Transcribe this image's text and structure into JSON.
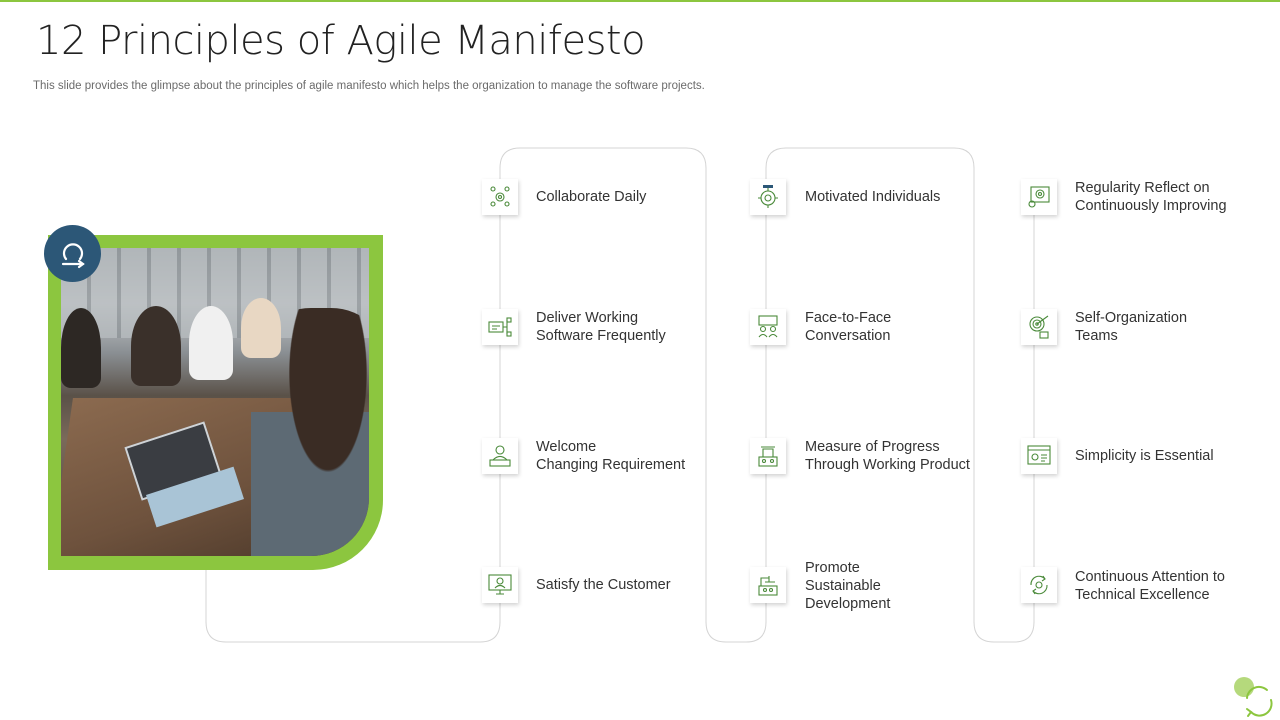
{
  "slide": {
    "title": "12 Principles of Agile Manifesto",
    "subtitle": "This slide provides the glimpse about the principles of agile manifesto which helps the organization to manage the software projects."
  },
  "colors": {
    "accent": "#8cc63f",
    "badge": "#2c5777",
    "line": "#d4d4d4"
  },
  "badge_icon": "scrum-cycle-icon",
  "principles": [
    {
      "label": "Collaborate Daily",
      "icon": "team-collaboration-icon"
    },
    {
      "label": "Deliver Working\nSoftware Frequently",
      "icon": "software-delivery-icon"
    },
    {
      "label": "Welcome\nChanging Requirement",
      "icon": "person-desk-icon"
    },
    {
      "label": "Satisfy the Customer",
      "icon": "customer-screen-icon"
    },
    {
      "label": "Motivated Individuals",
      "icon": "gear-person-icon"
    },
    {
      "label": "Face-to-Face\nConversation",
      "icon": "conversation-icon"
    },
    {
      "label": "Measure of Progress\nThrough Working Product",
      "icon": "progress-machine-icon"
    },
    {
      "label": "Promote\nSustainable\nDevelopment",
      "icon": "development-machine-icon"
    },
    {
      "label": "Regularity Reflect on\nContinuously Improving",
      "icon": "improvement-gear-icon"
    },
    {
      "label": "Self-Organization\nTeams",
      "icon": "target-team-icon"
    },
    {
      "label": "Simplicity is Essential",
      "icon": "simple-screen-icon"
    },
    {
      "label": "Continuous Attention to\nTechnical Excellence",
      "icon": "cycle-excellence-icon"
    }
  ]
}
